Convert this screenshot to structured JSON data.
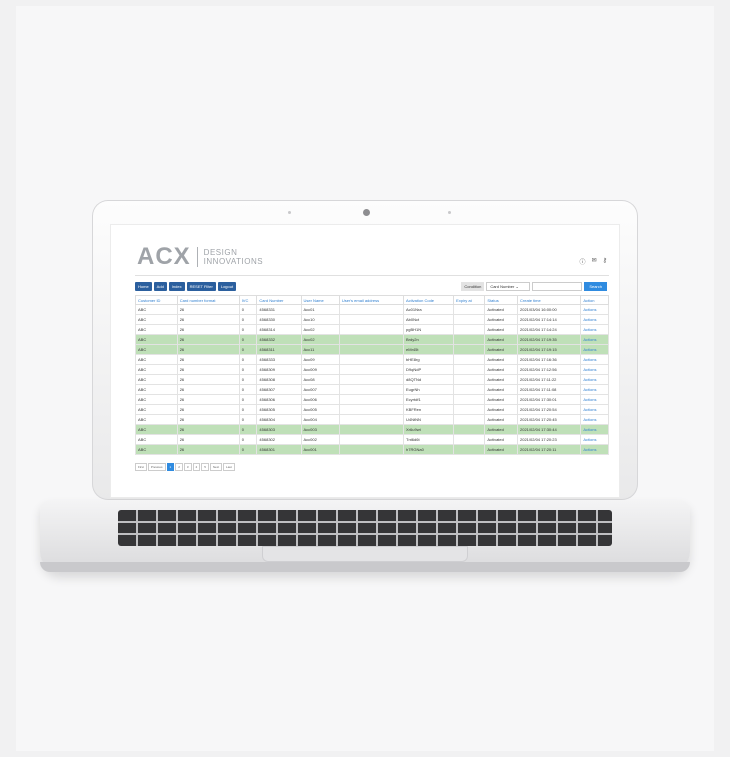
{
  "logo": {
    "main": "ACX",
    "sub1": "DESIGN",
    "sub2": "INNOVATIONS"
  },
  "top_icons": [
    "info-icon",
    "mail-icon",
    "key-icon"
  ],
  "nav": [
    "Home",
    "Add",
    "Index",
    "RESET Filter",
    "Logout"
  ],
  "search": {
    "condition_label": "Condition",
    "condition_value": "Card Number",
    "button": "Search"
  },
  "table": {
    "headers": [
      "Customer ID",
      "Card number format",
      "IVC",
      "Card Number",
      "User Name",
      "User's email address",
      "Activation Code",
      "Expiry at",
      "Status",
      "Create time",
      "Action"
    ],
    "rows": [
      [
        "ABC",
        "26",
        "0",
        "4568331",
        "Acc01",
        "",
        "Ac01Nra",
        "",
        "Activated",
        "2021/03/04 16:00:00",
        "Actions"
      ],
      [
        "ABC",
        "26",
        "0",
        "4568330",
        "Acc10",
        "",
        "Ab0Nct",
        "",
        "Activated",
        "2021/02/04 17:14:14",
        "Actions"
      ],
      [
        "ABC",
        "26",
        "0",
        "4568314",
        "Acc02",
        "",
        "pgBH1N",
        "",
        "Activated",
        "2021/02/04 17:14:24",
        "Actions"
      ],
      [
        "ABC",
        "26",
        "0",
        "4568332",
        "Acc02",
        "",
        "Brdy2n",
        "",
        "Activated",
        "2021/02/04 17:19:35",
        "Actions"
      ],
      [
        "ABC",
        "26",
        "0",
        "4568311",
        "Acc11",
        "",
        "eMr45t",
        "",
        "Activated",
        "2021/02/04 17:19:15",
        "Actions"
      ],
      [
        "ABC",
        "26",
        "0",
        "4568333",
        "Acc09",
        "",
        "bHE8rg",
        "",
        "Activated",
        "2021/02/04 17:16:36",
        "Actions"
      ],
      [
        "ABC",
        "26",
        "0",
        "4568309",
        "Acc009",
        "",
        "D9qNdP",
        "",
        "Activated",
        "2021/02/04 17:12:56",
        "Actions"
      ],
      [
        "ABC",
        "26",
        "0",
        "4568308",
        "Acc08",
        "",
        "d8QTNd",
        "",
        "Activated",
        "2021/02/04 17:11:22",
        "Actions"
      ],
      [
        "ABC",
        "26",
        "0",
        "4568307",
        "Acc007",
        "",
        "EugrNh",
        "",
        "Activated",
        "2021/02/04 17:11:08",
        "Actions"
      ],
      [
        "ABC",
        "26",
        "0",
        "4568306",
        "Acc006",
        "",
        "Ecyrtdf1",
        "",
        "Activated",
        "2021/02/04 17:30:01",
        "Actions"
      ],
      [
        "ABC",
        "26",
        "0",
        "4568305",
        "Acc005",
        "",
        "KBFRen",
        "",
        "Activated",
        "2021/02/04 17:20:54",
        "Actions"
      ],
      [
        "ABC",
        "26",
        "0",
        "4568304",
        "Acc004",
        "",
        "U4NtNN",
        "",
        "Activated",
        "2021/02/04 17:20:45",
        "Actions"
      ],
      [
        "ABC",
        "26",
        "0",
        "4568303",
        "Acc003",
        "",
        "Xr6u9wt",
        "",
        "Activated",
        "2021/02/04 17:30:44",
        "Actions"
      ],
      [
        "ABC",
        "26",
        "0",
        "4568302",
        "Acc002",
        "",
        "Tnt6d6t",
        "",
        "Activated",
        "2021/02/04 17:20:23",
        "Actions"
      ],
      [
        "ABC",
        "26",
        "0",
        "4568301",
        "Acc001",
        "",
        "h7RGNa0",
        "",
        "Activated",
        "2021/02/04 17:20:11",
        "Actions"
      ]
    ],
    "highlighted_rows": [
      3,
      4,
      12,
      14
    ]
  },
  "pager": [
    "First",
    "Previous",
    "1",
    "2",
    "3",
    "4",
    "5",
    "Next",
    "Last"
  ],
  "colors": {
    "nav": "#2b5f9e",
    "highlight": "#bfe0b8",
    "link": "#2f7fd0"
  }
}
